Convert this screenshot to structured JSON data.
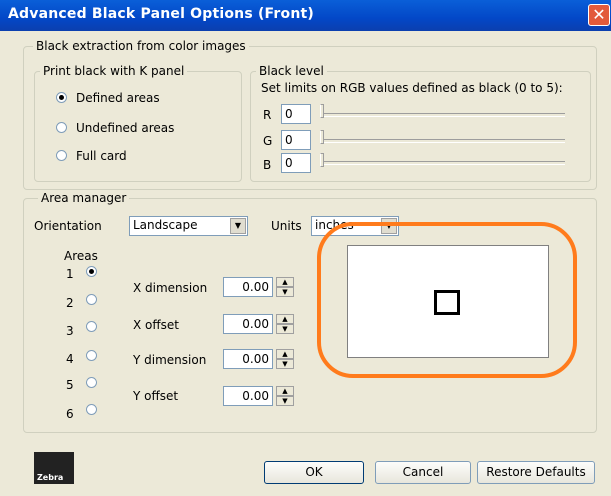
{
  "window": {
    "title": "Advanced Black Panel Options (Front)",
    "close_glyph": "✕"
  },
  "extraction_group": {
    "label": "Black extraction from color images"
  },
  "print_black_group": {
    "label": "Print black with K panel",
    "options": [
      {
        "label": "Defined areas",
        "checked": true
      },
      {
        "label": "Undefined areas",
        "checked": false
      },
      {
        "label": "Full card",
        "checked": false
      }
    ]
  },
  "black_level_group": {
    "label": "Black level",
    "description": "Set limits on RGB values defined as black (0 to 5):",
    "channels": [
      {
        "label": "R",
        "value": "0"
      },
      {
        "label": "G",
        "value": "0"
      },
      {
        "label": "B",
        "value": "0"
      }
    ]
  },
  "area_manager": {
    "label": "Area manager",
    "orientation_label": "Orientation",
    "orientation_value": "Landscape",
    "units_label": "Units",
    "units_value": "inches",
    "areas_label": "Areas",
    "areas": [
      {
        "num": "1",
        "checked": true
      },
      {
        "num": "2",
        "checked": false
      },
      {
        "num": "3",
        "checked": false
      },
      {
        "num": "4",
        "checked": false
      },
      {
        "num": "5",
        "checked": false
      },
      {
        "num": "6",
        "checked": false
      }
    ],
    "fields": [
      {
        "label": "X dimension",
        "value": "0.00"
      },
      {
        "label": "X offset",
        "value": "0.00"
      },
      {
        "label": "Y dimension",
        "value": "0.00"
      },
      {
        "label": "Y offset",
        "value": "0.00"
      }
    ]
  },
  "footer": {
    "logo_text": "Zebra",
    "ok_label": "OK",
    "cancel_label": "Cancel",
    "restore_label": "Restore Defaults"
  },
  "colors": {
    "title_bar": "#0347c7",
    "highlight": "#ff7b1c",
    "dialog_bg": "#ece9d8"
  }
}
